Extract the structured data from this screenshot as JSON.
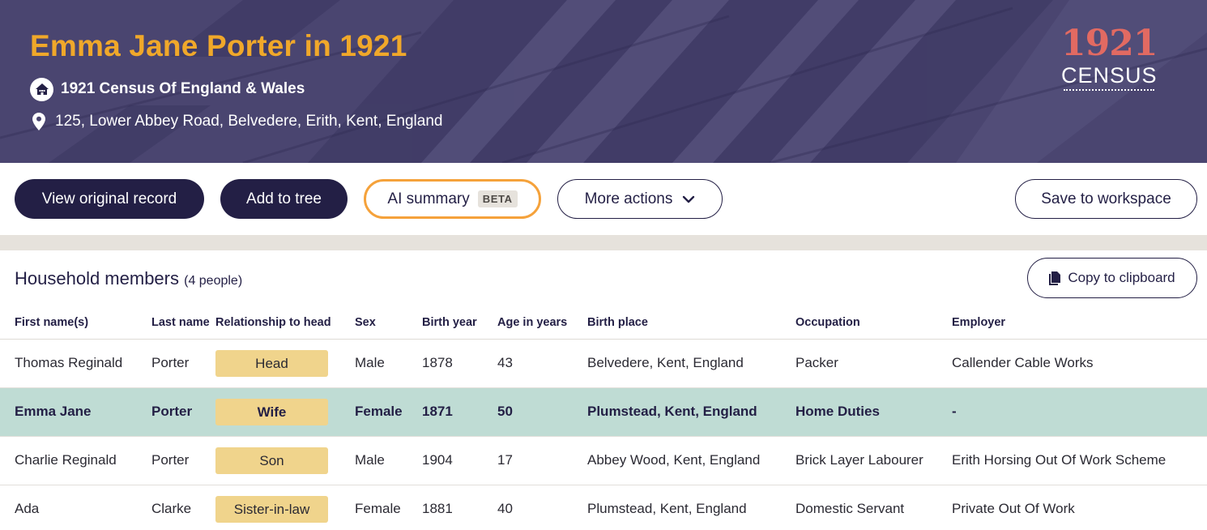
{
  "header": {
    "title": "Emma Jane Porter in 1921",
    "collection": "1921 Census Of England & Wales",
    "address": "125, Lower Abbey Road, Belvedere, Erith, Kent, England",
    "logo": {
      "year": "1921",
      "word": "CENSUS"
    },
    "colors": {
      "background": "#4a4570",
      "title": "#f0a82a",
      "logo_year": "#e26a62"
    }
  },
  "actions": {
    "view_original": "View original record",
    "add_to_tree": "Add to tree",
    "ai_summary": "AI summary",
    "ai_badge": "BETA",
    "more_actions": "More actions",
    "save_workspace": "Save to workspace"
  },
  "household": {
    "title": "Household members",
    "count": "(4 people)",
    "copy_label": "Copy to clipboard",
    "columns": [
      "First name(s)",
      "Last name",
      "Relationship to head",
      "Sex",
      "Birth year",
      "Age in years",
      "Birth place",
      "Occupation",
      "Employer"
    ],
    "rows": [
      [
        "Thomas Reginald",
        "Porter",
        "Head",
        "Male",
        "1878",
        "43",
        "Belvedere, Kent, England",
        "Packer",
        "Callender Cable Works"
      ],
      [
        "Emma Jane",
        "Porter",
        "Wife",
        "Female",
        "1871",
        "50",
        "Plumstead, Kent, England",
        "Home Duties",
        "-"
      ],
      [
        "Charlie Reginald",
        "Porter",
        "Son",
        "Male",
        "1904",
        "17",
        "Abbey Wood, Kent, England",
        "Brick Layer Labourer",
        "Erith Horsing Out Of Work Scheme"
      ],
      [
        "Ada",
        "Clarke",
        "Sister-in-law",
        "Female",
        "1881",
        "40",
        "Plumstead, Kent, England",
        "Domestic Servant",
        "Private Out Of Work"
      ]
    ],
    "highlight_row": 1,
    "colors": {
      "highlight": "#bfdcd4",
      "badge": "#f0d48c",
      "accent_dark": "#231f45",
      "ai_border": "#f5a23b"
    }
  },
  "icons": {
    "census": "house-icon",
    "address": "map-pin-icon",
    "more": "chevron-down-icon",
    "copy": "document-icon"
  }
}
